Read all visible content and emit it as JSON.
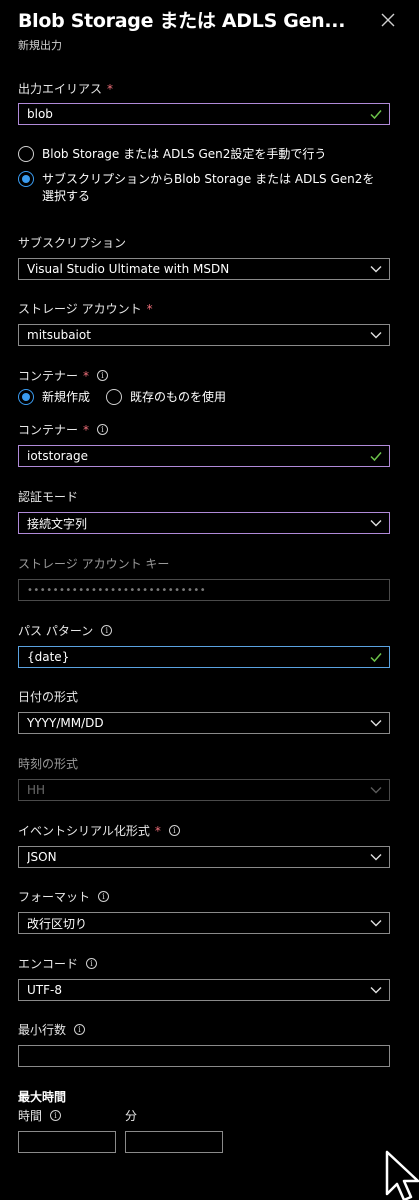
{
  "header": {
    "title": "Blob Storage または ADLS Gen...",
    "subtitle": "新規出力",
    "close_icon": "close-icon"
  },
  "output_alias": {
    "label": "出力エイリアス",
    "required": "*",
    "value": "blob"
  },
  "source_options": [
    {
      "label": "Blob Storage または ADLS Gen2設定を手動で行う",
      "selected": false
    },
    {
      "label_line1": "サブスクリプションからBlob Storage または ADLS Gen2を",
      "label_line2": "選択する",
      "selected": true
    }
  ],
  "subscription": {
    "label": "サブスクリプション",
    "value": "Visual Studio Ultimate with MSDN"
  },
  "storage_account": {
    "label": "ストレージ アカウント",
    "required": "*",
    "value": "mitsubaiot"
  },
  "container_mode": {
    "label": "コンテナー",
    "required": "*",
    "options": [
      {
        "label": "新規作成",
        "selected": true
      },
      {
        "label": "既存のものを使用",
        "selected": false
      }
    ]
  },
  "container": {
    "label": "コンテナー",
    "required": "*",
    "value": "iotstorage"
  },
  "auth_mode": {
    "label": "認証モード",
    "value": "接続文字列"
  },
  "storage_key": {
    "label": "ストレージ アカウント キー",
    "value": "••••••••••••••••••••••••••••"
  },
  "path_pattern": {
    "label": "パス パターン",
    "value": "{date}"
  },
  "date_format": {
    "label": "日付の形式",
    "value": "YYYY/MM/DD"
  },
  "time_format": {
    "label": "時刻の形式",
    "value": "HH"
  },
  "event_serialization": {
    "label": "イベントシリアル化形式",
    "required": "*",
    "value": "JSON"
  },
  "format": {
    "label": "フォーマット",
    "value": "改行区切り"
  },
  "encoding": {
    "label": "エンコード",
    "value": "UTF-8"
  },
  "min_rows": {
    "label": "最小行数",
    "value": ""
  },
  "max_time": {
    "label": "最大時間",
    "hours_label": "時間",
    "minutes_label": "分",
    "hours_value": "",
    "minutes_value": ""
  },
  "colors": {
    "background": "#000000",
    "accent_blue": "#3a9bef",
    "focus_purple": "#b08ad8",
    "valid_green": "#6cc24a",
    "required_red": "#f1707b"
  }
}
